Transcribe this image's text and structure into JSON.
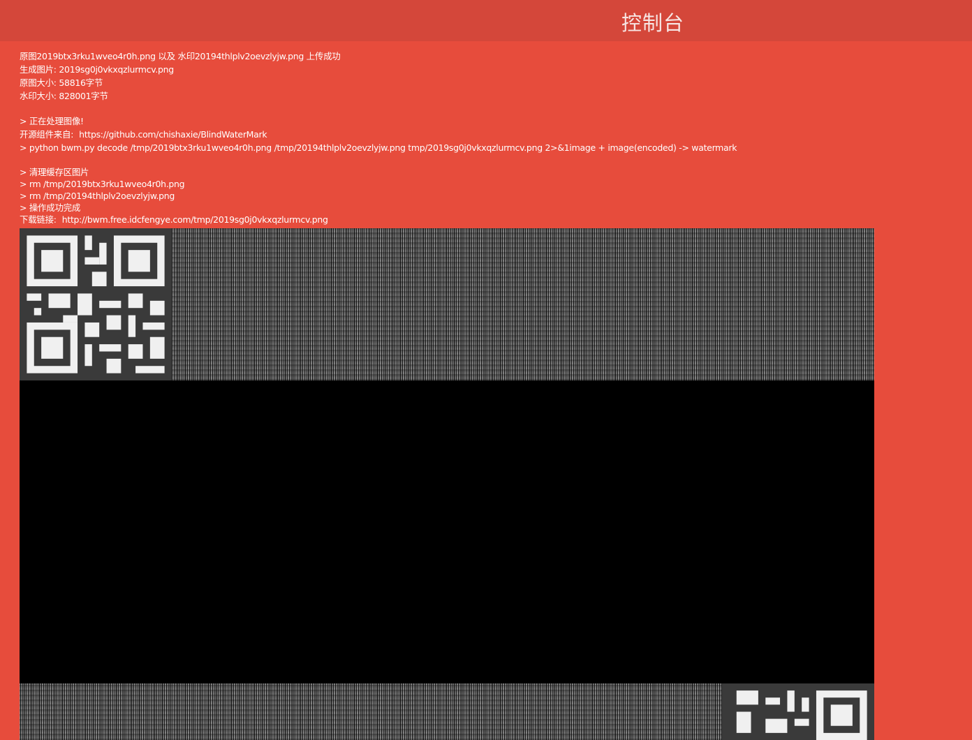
{
  "header": {
    "title": "控制台"
  },
  "log": {
    "upload_success": "原图2019btx3rku1wveo4r0h.png 以及 水印20194thlplv2oevzlyjw.png 上传成功",
    "output_image": "生成图片: 2019sg0j0vkxqzlurmcv.png",
    "original_size": "原图大小: 58816字节",
    "watermark_size": "水印大小: 828001字节",
    "processing": "> 正在处理图像!",
    "source_label": "开源组件来自:",
    "source_link": "https://github.com/chishaxie/BlindWaterMark",
    "command": "> python bwm.py decode /tmp/2019btx3rku1wveo4r0h.png /tmp/20194thlplv2oevzlyjw.png tmp/2019sg0j0vkxqzlurmcv.png 2>&1image + image(encoded) -> watermark",
    "cleanup": "> 清理缓存区图片",
    "rm_original": "> rm /tmp/2019btx3rku1wveo4r0h.png",
    "rm_watermark": "> rm /tmp/20194thlplv2oevzlyjw.png",
    "done": "> 操作成功完成",
    "download_label": "下载链接:",
    "download_link": "http://bwm.free.idcfengye.com/tmp/2019sg0j0vkxqzlurmcv.png"
  },
  "colors": {
    "page_background": "#e74c3c",
    "header_background": "#d4473a",
    "text": "#ffffff"
  },
  "icons": {
    "result_image": "decoded-watermark-image",
    "qr_code": "qr-code-icon"
  }
}
